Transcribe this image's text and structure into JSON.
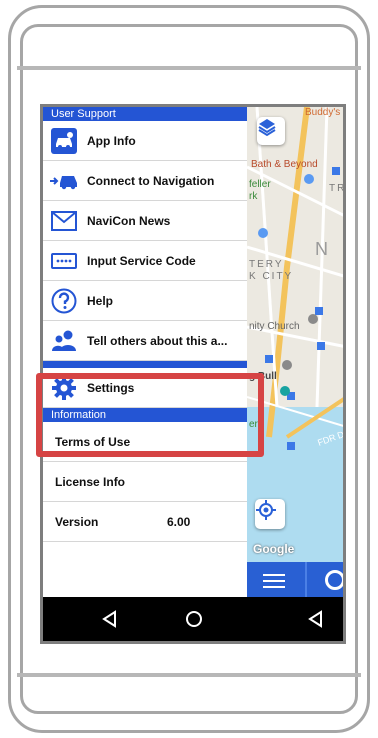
{
  "drawer": {
    "user_support_header": "User Support",
    "items": [
      {
        "label": "App Info",
        "icon": "car-info-icon"
      },
      {
        "label": "Connect to Navigation",
        "icon": "connect-car-icon"
      },
      {
        "label": "NaviCon News",
        "icon": "envelope-icon"
      },
      {
        "label": "Input Service Code",
        "icon": "code-input-icon"
      },
      {
        "label": "Help",
        "icon": "question-icon"
      },
      {
        "label": "Tell others about this a...",
        "icon": "people-icon"
      }
    ],
    "settings_label": "Settings",
    "information_header": "Information",
    "info_items": {
      "terms": "Terms of Use",
      "license": "License Info",
      "version_label": "Version",
      "version_value": "6.00"
    }
  },
  "map": {
    "labels": {
      "l1": "Buddy's",
      "l2": "Bath & Beyond",
      "l3": "feller",
      "l4": "rk",
      "l5": "TR",
      "l6": "N",
      "l7": "TERY",
      "l8": "K CITY",
      "l9": "nity Church",
      "l10": "g Bull",
      "l11": "ery",
      "l12": "FDR Dr"
    },
    "google": "Google"
  },
  "colors": {
    "drawer_blue": "#2455d4",
    "highlight": "#d64444",
    "icon_blue": "#2455d4"
  }
}
